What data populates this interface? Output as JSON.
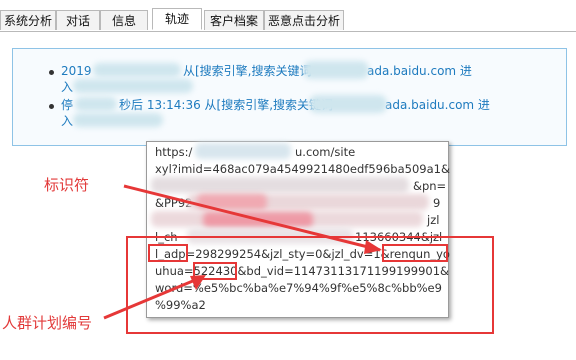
{
  "tabs": [
    {
      "label": "系统分析",
      "active": false
    },
    {
      "label": "对话",
      "active": false
    },
    {
      "label": "信息",
      "active": false
    },
    {
      "label": "轨迹",
      "active": true
    },
    {
      "label": "客户档案",
      "active": false
    },
    {
      "label": "恶意点击分析",
      "active": false
    }
  ],
  "trail": {
    "item1_line1_start": "2019",
    "item1_line1_mid": "从[搜索引擎,搜索关键词",
    "item1_line1_end": "ada.baidu.com 进",
    "item1_line2": "入",
    "item2_line1_start": "停",
    "item2_line1_mid": "秒后 13:14:36 从[搜索引擎,搜索关键词",
    "item2_line1_end": "ada.baidu.com 进",
    "item2_line2": "入"
  },
  "tooltip": {
    "l1": "https:/",
    "l1b": "u.com/site",
    "l2": "xyl?imid=468ac079a4549921480edf596ba509a1&",
    "l3_end": "&pn=",
    "l4a": "&PP92",
    "l4_end": "9",
    "l5_end": "jzl",
    "l6a": "l_ch",
    "l6_end": "113660344&jzl",
    "l7": "l_adp=298299254&jzl_sty=0&jzl_dv=1&renqun_yo",
    "l8": "uhua=522430&bd_vid=11473113171199199901&",
    "l9": "word=%e5%bc%ba%e7%94%9f%e5%8c%bb%e9",
    "l10": "%99%a2"
  },
  "annotations": {
    "identifier": "标识符",
    "crowd_plan_id": "人群计划编号"
  },
  "colors": {
    "annotation_red": "#e63737",
    "link_blue": "#1e7bbf"
  }
}
